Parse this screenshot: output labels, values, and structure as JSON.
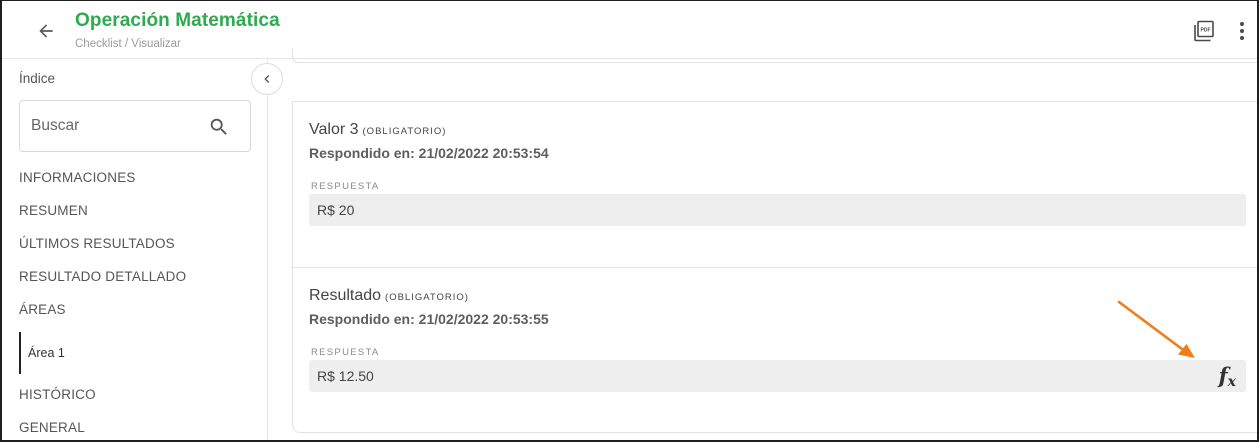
{
  "header": {
    "title": "Operación Matemática",
    "breadcrumb": "Checklist / Visualizar",
    "icons": [
      "arrow-back-icon",
      "pdf-icon",
      "more-vert-icon"
    ]
  },
  "sidebar": {
    "index_title": "Índice",
    "search": {
      "placeholder": "Buscar",
      "value": ""
    },
    "items": [
      {
        "label": "INFORMACIONES"
      },
      {
        "label": "RESUMEN"
      },
      {
        "label": "ÚLTIMOS RESULTADOS"
      },
      {
        "label": "RESULTADO DETALLADO"
      },
      {
        "label": "ÁREAS"
      },
      {
        "label": "HISTÓRICO"
      },
      {
        "label": "GENERAL"
      }
    ],
    "sub_item": {
      "label": "Área 1"
    }
  },
  "main": {
    "questions": [
      {
        "title": "Valor 3",
        "required": "(OBLIGATORIO)",
        "answered": "Respondido en: 21/02/2022 20:53:54",
        "response_label": "RESPUESTA",
        "response_value": "R$ 20"
      },
      {
        "title": "Resultado",
        "required": "(OBLIGATORIO)",
        "answered": "Respondido en: 21/02/2022 20:53:55",
        "response_label": "RESPUESTA",
        "response_value": "R$ 12.50",
        "formula_icon": "fx"
      }
    ]
  },
  "colors": {
    "title_green": "#2eab4e",
    "annotation_arrow": "#f07d1a",
    "response_bg": "#eeeeee"
  }
}
